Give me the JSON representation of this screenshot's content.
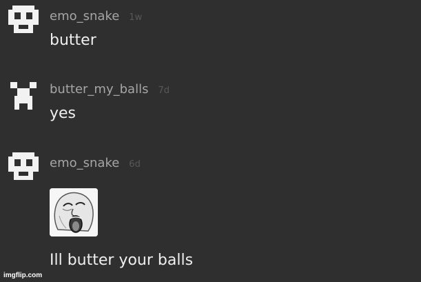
{
  "comments": [
    {
      "username": "emo_snake",
      "time": "1w",
      "text": "butter",
      "avatar_icon": "pixel-skull-icon"
    },
    {
      "username": "butter_my_balls",
      "time": "7d",
      "text": "yes",
      "avatar_icon": "pixel-creeper-icon"
    },
    {
      "username": "emo_snake",
      "time": "6d",
      "image_icon": "lol-face-meme-icon",
      "text": "Ill butter your balls",
      "avatar_icon": "pixel-skull-icon"
    }
  ],
  "watermark": "imgflip.com",
  "colors": {
    "background": "#2f2f2f",
    "username": "#a6a6a6",
    "timestamp": "#585858",
    "body_text": "#efefef"
  }
}
